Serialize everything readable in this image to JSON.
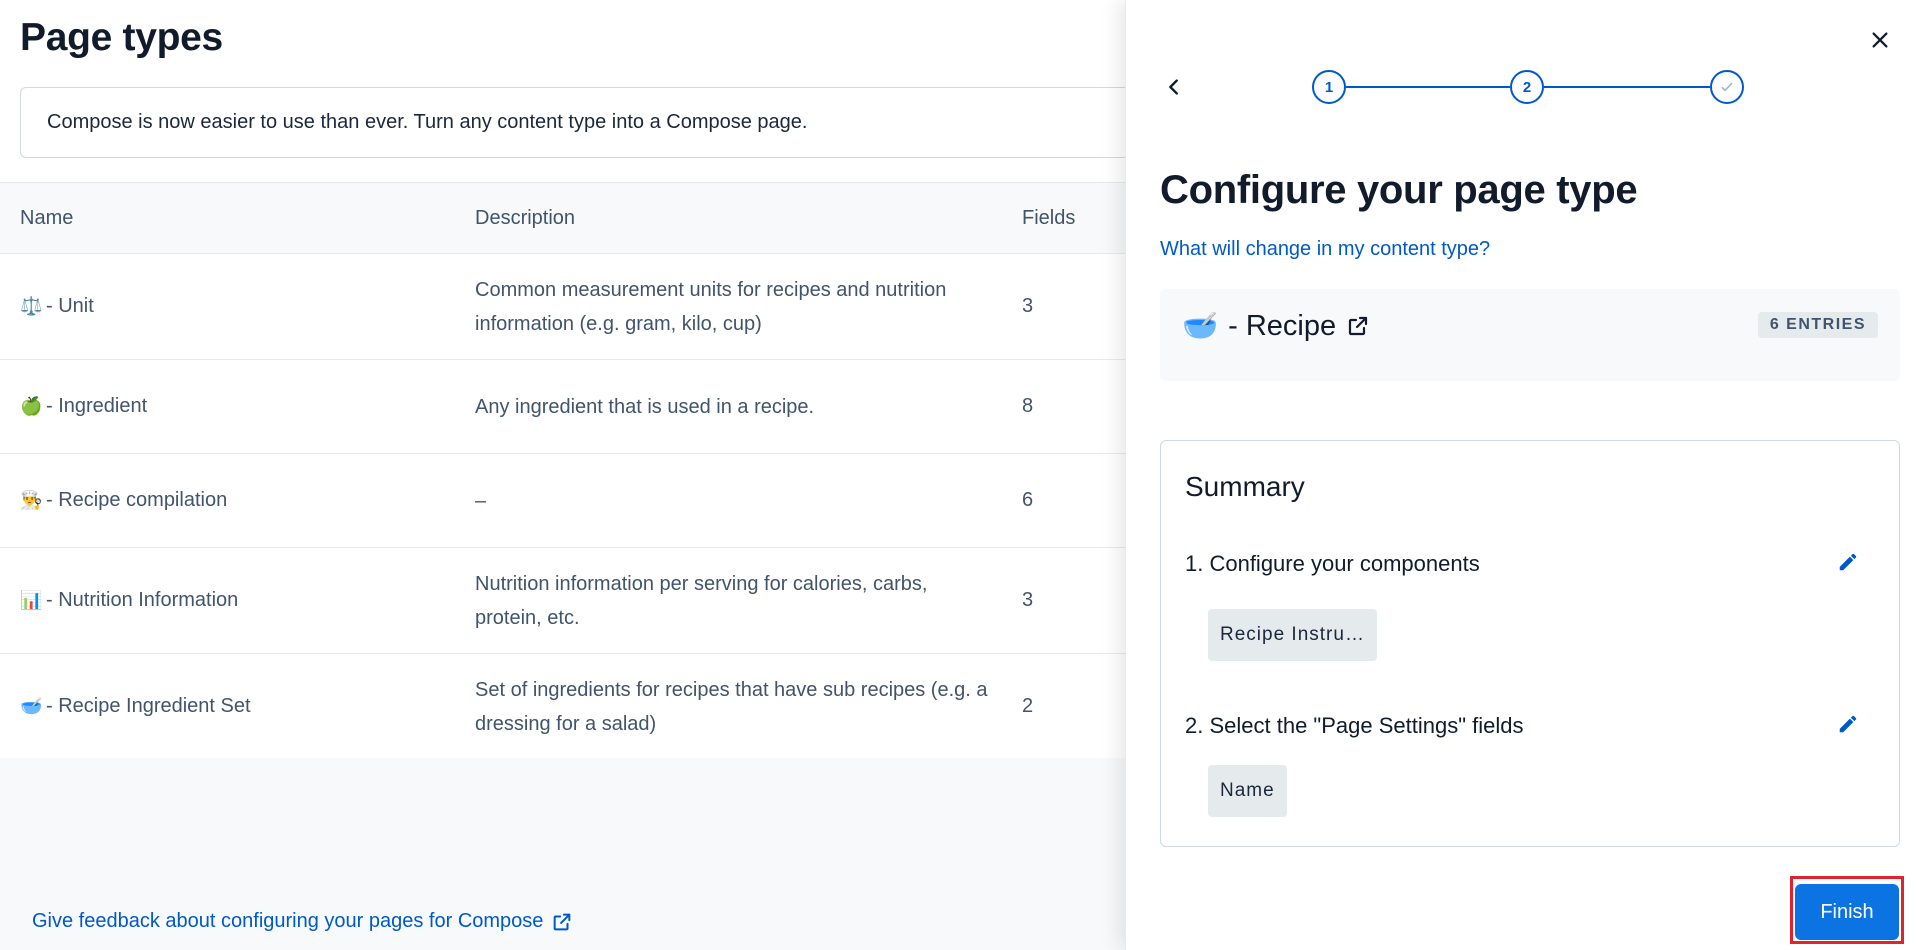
{
  "page": {
    "title": "Page types",
    "notice": "Compose is now easier to use than ever. Turn any content type into a Compose page.",
    "feedback_link": "Give feedback about configuring your pages for Compose"
  },
  "table": {
    "headers": {
      "name": "Name",
      "description": "Description",
      "fields": "Fields"
    },
    "rows": [
      {
        "emoji": "⚖️",
        "name": "- Unit",
        "description": "Common measurement units for recipes and nutrition information (e.g. gram, kilo, cup)",
        "fields": "3"
      },
      {
        "emoji": "🍏",
        "name": "- Ingredient",
        "description": "Any ingredient that is used in a recipe.",
        "fields": "8"
      },
      {
        "emoji": "👨‍🍳",
        "name": "- Recipe compilation",
        "description": "–",
        "fields": "6"
      },
      {
        "emoji": "📊",
        "name": "- Nutrition Information",
        "description": "Nutrition information per serving for calories, carbs, protein, etc.",
        "fields": "3"
      },
      {
        "emoji": "🥣",
        "name": "- Recipe Ingredient Set",
        "description": "Set of ingredients for recipes that have sub recipes (e.g. a dressing for a salad)",
        "fields": "2"
      }
    ]
  },
  "modal": {
    "steps": [
      "1",
      "2"
    ],
    "title": "Configure your page type",
    "help_link": "What will change in my content type?",
    "content_type": {
      "emoji": "🥣",
      "name": "- Recipe",
      "entries": "6 ENTRIES"
    },
    "summary": {
      "title": "Summary",
      "sections": [
        {
          "heading": "1. Configure your components",
          "pills": [
            "Recipe Instru…"
          ]
        },
        {
          "heading": "2. Select the \"Page Settings\" fields",
          "pills": [
            "Name"
          ]
        }
      ]
    },
    "finish_label": "Finish"
  },
  "colors": {
    "accent": "#0059c8",
    "button": "#0b74e2",
    "highlight": "#e0232e"
  }
}
